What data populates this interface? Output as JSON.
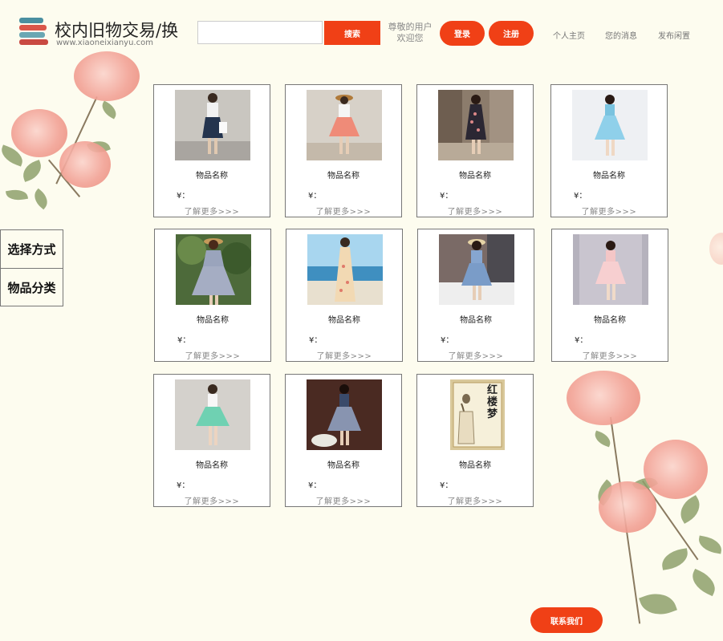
{
  "header": {
    "logo_title": "校内旧物交易/换",
    "logo_url": "www.xiaoneixianyu.com",
    "search_placeholder": "",
    "search_button": "搜索",
    "welcome_line1": "尊敬的用户",
    "welcome_line2": "欢迎您",
    "login_button": "登录",
    "register_button": "注册",
    "nav": [
      "个人主页",
      "您的消息",
      "发布闲置"
    ]
  },
  "sidebar": {
    "items": [
      "选择方式",
      "物品分类"
    ]
  },
  "products": [
    {
      "name": "物品名称",
      "price": "¥：",
      "more": "了解更多>>>",
      "image": "dress-denim-skirt"
    },
    {
      "name": "物品名称",
      "price": "¥：",
      "more": "了解更多>>>",
      "image": "dress-pink-skirt"
    },
    {
      "name": "物品名称",
      "price": "¥：",
      "more": "了解更多>>>",
      "image": "dress-floral-black"
    },
    {
      "name": "物品名称",
      "price": "¥：",
      "more": "了解更多>>>",
      "image": "dress-light-blue"
    },
    {
      "name": "物品名称",
      "price": "¥：",
      "more": "了解更多>>>",
      "image": "dress-gray-floral"
    },
    {
      "name": "物品名称",
      "price": "¥：",
      "more": "了解更多>>>",
      "image": "dress-beach-maxi"
    },
    {
      "name": "物品名称",
      "price": "¥：",
      "more": "了解更多>>>",
      "image": "dress-blue-denim"
    },
    {
      "name": "物品名称",
      "price": "¥：",
      "more": "了解更多>>>",
      "image": "dress-pink-lace"
    },
    {
      "name": "物品名称",
      "price": "¥：",
      "more": "了解更多>>>",
      "image": "dress-mint-skirt"
    },
    {
      "name": "物品名称",
      "price": "¥：",
      "more": "了解更多>>>",
      "image": "dress-plaid"
    },
    {
      "name": "物品名称",
      "price": "¥：",
      "more": "了解更多>>>",
      "image": "book-hongloumeng"
    }
  ],
  "book_cover_title": "红楼梦",
  "footer": {
    "contact_button": "联系我们"
  },
  "colors": {
    "accent": "#f04016",
    "background": "#fdfcef"
  }
}
